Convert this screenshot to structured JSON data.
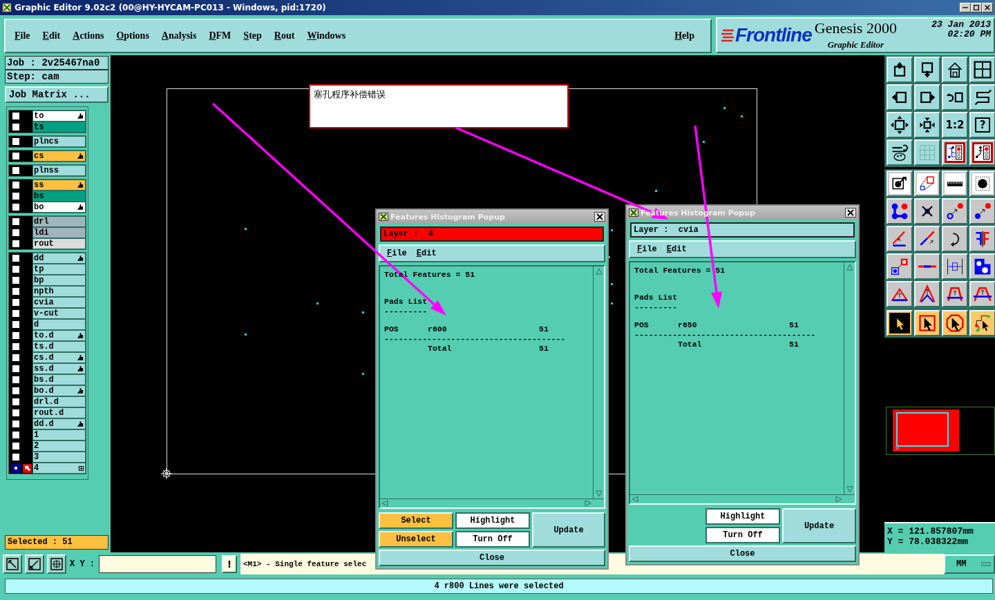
{
  "window": {
    "title": "Graphic Editor 9.02c2 (00@HY-HYCAM-PC013 - Windows, pid:1720)"
  },
  "menu": [
    {
      "label": "File"
    },
    {
      "label": "Edit"
    },
    {
      "label": "Actions"
    },
    {
      "label": "Options"
    },
    {
      "label": "Analysis"
    },
    {
      "label": "DFM"
    },
    {
      "label": "Step"
    },
    {
      "label": "Rout"
    },
    {
      "label": "Windows"
    }
  ],
  "help_menu": "Help",
  "branding": {
    "logo": "Frontline",
    "product": "Genesis 2000",
    "subtitle": "Graphic Editor",
    "date": "23 Jan 2013",
    "time": "02:20 PM"
  },
  "job": "Job : 2v25467na0",
  "step": "Step: cam",
  "job_matrix_button": "Job Matrix ...",
  "layer_groups": [
    {
      "layers": [
        {
          "name": "to",
          "color": "#ffffff",
          "affected": true,
          "work": false
        },
        {
          "name": "ts",
          "color": "#00a080",
          "affected": false,
          "work": false
        }
      ]
    },
    {
      "layers": [
        {
          "name": "plncs",
          "color": "#a0dcdc",
          "affected": false,
          "work": false
        }
      ]
    },
    {
      "layers": [
        {
          "name": "cs",
          "color": "#ffc040",
          "affected": true,
          "work": false
        }
      ]
    },
    {
      "layers": [
        {
          "name": "plnss",
          "color": "#a0dcdc",
          "affected": false,
          "work": false
        }
      ]
    },
    {
      "layers": [
        {
          "name": "ss",
          "color": "#ffc040",
          "affected": true,
          "work": false
        },
        {
          "name": "bs",
          "color": "#00a080",
          "affected": false,
          "work": false
        },
        {
          "name": "bo",
          "color": "#ffffff",
          "affected": true,
          "work": false
        }
      ]
    },
    {
      "layers": [
        {
          "name": "drl",
          "color": "#a0b4bc",
          "affected": false,
          "work": false
        },
        {
          "name": "ldi",
          "color": "#a0b4bc",
          "affected": false,
          "work": false
        },
        {
          "name": "rout",
          "color": "#dcdcdc",
          "affected": false,
          "work": false
        }
      ]
    },
    {
      "layers": [
        {
          "name": "dd",
          "color": "#a0dcdc",
          "affected": true,
          "work": false
        },
        {
          "name": "tp",
          "color": "#a0dcdc",
          "affected": false,
          "work": false
        },
        {
          "name": "bp",
          "color": "#a0dcdc",
          "affected": false,
          "work": false
        },
        {
          "name": "npth",
          "color": "#a0dcdc",
          "affected": false,
          "work": false
        },
        {
          "name": "cvia",
          "color": "#a0dcdc",
          "affected": false,
          "work": false
        },
        {
          "name": "v-cut",
          "color": "#a0dcdc",
          "affected": false,
          "work": false
        },
        {
          "name": "d",
          "color": "#a0dcdc",
          "affected": false,
          "work": false
        },
        {
          "name": "to.d",
          "color": "#a0dcdc",
          "affected": true,
          "work": false
        },
        {
          "name": "ts.d",
          "color": "#a0dcdc",
          "affected": false,
          "work": false
        },
        {
          "name": "cs.d",
          "color": "#a0dcdc",
          "affected": true,
          "work": false
        },
        {
          "name": "ss.d",
          "color": "#a0dcdc",
          "affected": true,
          "work": false
        },
        {
          "name": "bs.d",
          "color": "#a0dcdc",
          "affected": false,
          "work": false
        },
        {
          "name": "bo.d",
          "color": "#a0dcdc",
          "affected": true,
          "work": false
        },
        {
          "name": "drl.d",
          "color": "#a0dcdc",
          "affected": false,
          "work": false
        },
        {
          "name": "rout.d",
          "color": "#a0dcdc",
          "affected": false,
          "work": false
        },
        {
          "name": "dd.d",
          "color": "#a0dcdc",
          "affected": true,
          "work": false
        },
        {
          "name": "1",
          "color": "#a0dcdc",
          "affected": false,
          "work": false
        },
        {
          "name": "2",
          "color": "#a0dcdc",
          "affected": false,
          "work": false
        },
        {
          "name": "3",
          "color": "#a0dcdc",
          "affected": false,
          "work": false
        },
        {
          "name": "4",
          "color": "#a0dcdc",
          "affected": false,
          "work": true
        }
      ]
    }
  ],
  "selected_count": "Selected : 51",
  "annotation": "塞孔程序补偿错误",
  "popups": [
    {
      "title": "Features Histogram Popup",
      "layer": "Layer :  4",
      "layer_highlighted": true,
      "menu": [
        "File",
        "Edit"
      ],
      "report": {
        "total": "Total Features = 51",
        "section": "Pads List",
        "rule": "---------",
        "rows": [
          {
            "symbol": "POS",
            "size": "r600",
            "count": "51"
          }
        ],
        "divider": "--------------------------------------",
        "total_label": "Total",
        "total_count": "51"
      },
      "buttons": [
        {
          "label": "Select",
          "kind": "primary"
        },
        {
          "label": "Unselect",
          "kind": "primary"
        },
        {
          "label": "Highlight",
          "kind": "secondary"
        },
        {
          "label": "Turn Off",
          "kind": "secondary"
        },
        {
          "label": "Update",
          "kind": "side"
        },
        {
          "label": "Close",
          "kind": "footer"
        }
      ]
    },
    {
      "title": "Features Histogram Popup",
      "layer": "Layer :  cvia",
      "layer_highlighted": false,
      "menu": [
        "File",
        "Edit"
      ],
      "report": {
        "total": "Total Features = 51",
        "section": "Pads List",
        "rule": "---------",
        "rows": [
          {
            "symbol": "POS",
            "size": "r650",
            "count": "51"
          }
        ],
        "divider": "--------------------------------------",
        "total_label": "Total",
        "total_count": "51"
      },
      "buttons": [
        {
          "label": "Highlight",
          "kind": "secondary"
        },
        {
          "label": "Turn Off",
          "kind": "secondary"
        },
        {
          "label": "Update",
          "kind": "side"
        },
        {
          "label": "Close",
          "kind": "footer"
        }
      ]
    }
  ],
  "toolbar": {
    "scale_label": "1:2",
    "help_label": "?"
  },
  "coordinates": [
    "X  =  121.857807mm",
    "Y  =  78.038322mm"
  ],
  "bottom_bar": {
    "xy_label": "X Y :",
    "alert_button": "!",
    "message": "<M1> - Single feature selec",
    "units": "MM"
  },
  "status": "4 r800 Lines were selected"
}
